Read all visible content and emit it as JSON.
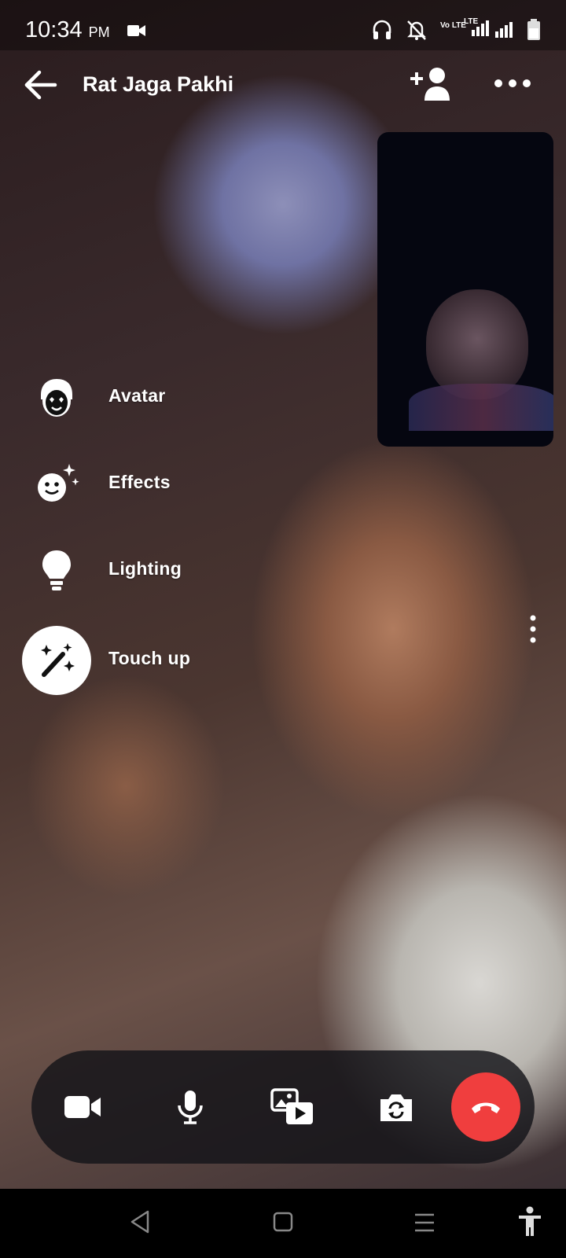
{
  "status_bar": {
    "time": "10:34",
    "ampm": "PM",
    "icons": [
      "video-camera-icon",
      "headphones-icon",
      "notifications-off-icon",
      "volte-icon",
      "lte-signal-icon",
      "signal-icon",
      "battery-icon"
    ],
    "volte_text": "Vo LTE",
    "lte_text": "LTE"
  },
  "header": {
    "title": "Rat Jaga Pakhi"
  },
  "menu": [
    {
      "label": "Avatar",
      "icon": "avatar-icon"
    },
    {
      "label": "Effects",
      "icon": "effects-icon"
    },
    {
      "label": "Lighting",
      "icon": "lightbulb-icon"
    },
    {
      "label": "Touch up",
      "icon": "magic-wand-icon"
    }
  ],
  "controls": {
    "buttons": [
      "video-toggle",
      "microphone",
      "share-media",
      "flip-camera",
      "end-call"
    ],
    "end_call_color": "#f03e3e"
  },
  "nav_bar": {
    "icons": [
      "back-triangle-icon",
      "home-square-icon",
      "recents-lines-icon",
      "accessibility-icon"
    ]
  }
}
